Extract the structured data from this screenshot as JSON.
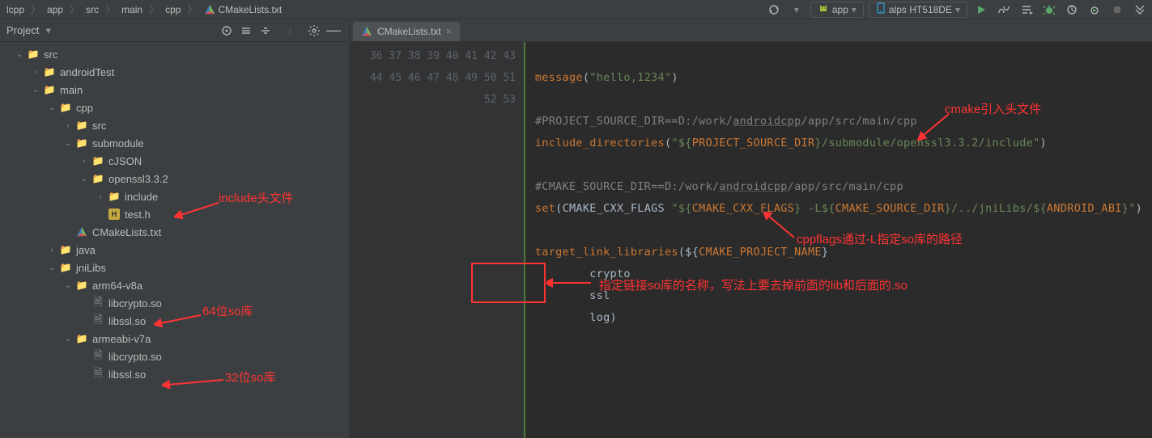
{
  "breadcrumb": {
    "items": [
      "lcpp",
      "app",
      "src",
      "main",
      "cpp",
      "CMakeLists.txt"
    ]
  },
  "toolbar": {
    "config_app": "app",
    "config_device": "alps HT518DE"
  },
  "project": {
    "title": "Project",
    "tree": {
      "src": "src",
      "androidTest": "androidTest",
      "main": "main",
      "cpp": "cpp",
      "src2": "src",
      "submodule": "submodule",
      "cJSON": "cJSON",
      "openssl": "openssl3.3.2",
      "include": "include",
      "test_h": "test.h",
      "cmake": "CMakeLists.txt",
      "java": "java",
      "jniLibs": "jniLibs",
      "arm64": "arm64-v8a",
      "libcrypto": "libcrypto.so",
      "libssl": "libssl.so",
      "armeabi": "armeabi-v7a",
      "libcrypto2": "libcrypto.so",
      "libssl2": "libssl.so"
    }
  },
  "editor": {
    "tab_name": "CMakeLists.txt",
    "line_start": 36,
    "line_end": 53,
    "code": {
      "l37": {
        "kw": "message",
        "paren": "(",
        "str": "\"hello,1234\"",
        "close": ")"
      },
      "l39": "#PROJECT_SOURCE_DIR==D:/work/androidcpp/app/src/main/cpp",
      "l40_kw": "include_directories",
      "l40_str_a": "\"${",
      "l40_var": "PROJECT_SOURCE_DIR",
      "l40_str_b": "}/submodule/openssl3.3.2/include\"",
      "l42": "#CMAKE_SOURCE_DIR==D:/work/androidcpp/app/src/main/cpp",
      "l43_kw": "set",
      "l43_a": "CMAKE_CXX_FLAGS ",
      "l43_s1": "\"${",
      "l43_v1": "CMAKE_CXX_FLAGS",
      "l43_s2": "} -L${",
      "l43_v2": "CMAKE_SOURCE_DIR",
      "l43_s3": "}/../jniLibs/${",
      "l43_v3": "ANDROID_ABI",
      "l43_s4": "}\"",
      "l45_kw": "target_link_libraries",
      "l45_a": "${",
      "l45_v": "CMAKE_PROJECT_NAME",
      "l45_b": "}",
      "l46": "        crypto",
      "l47": "        ssl",
      "l48": "        log)"
    }
  },
  "annotations": {
    "include_header": "include头文件",
    "so_64": "64位so库",
    "so_32": "32位so库",
    "cmake_header": "cmake引入头文件",
    "cppflags": "cppflags通过-L指定so库的路径",
    "link_so": "指定链接so库的名称，写法上要去掉前面的lib和后面的.so"
  }
}
